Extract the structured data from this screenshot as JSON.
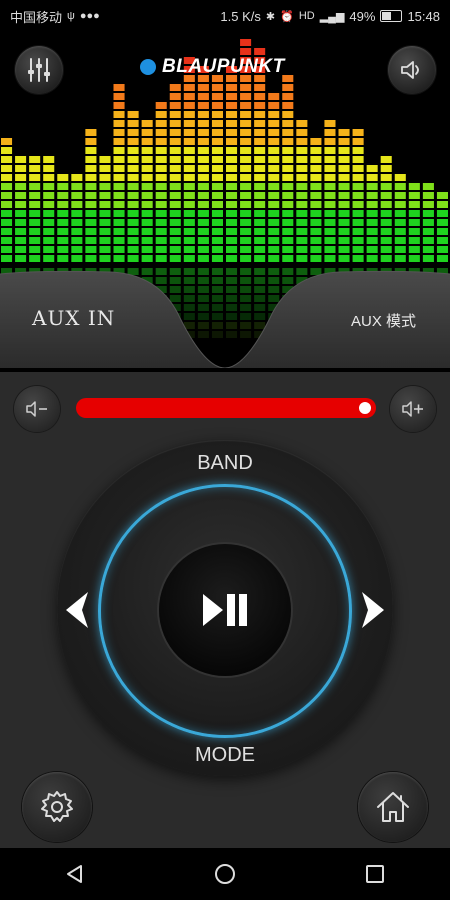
{
  "status_bar": {
    "carrier": "中国移动",
    "network_speed": "1.5 K/s",
    "battery": "49%",
    "time": "15:48",
    "signal_label": "HD"
  },
  "header": {
    "brand": "BLAUPUNKT",
    "eq_button_icon": "equalizer-sliders-icon",
    "sound_button_icon": "speaker-icon"
  },
  "source": {
    "left_label": "AUX IN",
    "right_label": "AUX 模式"
  },
  "volume": {
    "level": 1.0,
    "minus_icon": "volume-down-icon",
    "plus_icon": "volume-up-icon",
    "track_color": "#e60000"
  },
  "dial": {
    "top_label": "BAND",
    "bottom_label": "MODE",
    "center_icon": "play-pause-icon",
    "ring_color": "#3aa8d8"
  },
  "footer": {
    "settings_icon": "gear-icon",
    "home_icon": "home-icon"
  },
  "nav": {
    "back_icon": "back-triangle-icon",
    "home_icon": "circle-home-icon",
    "recents_icon": "square-recents-icon"
  },
  "eq_levels": [
    14,
    12,
    12,
    12,
    10,
    10,
    15,
    12,
    20,
    17,
    16,
    18,
    20,
    23,
    22,
    21,
    22,
    25,
    24,
    19,
    21,
    16,
    14,
    16,
    15,
    15,
    11,
    12,
    10,
    9,
    9,
    8
  ]
}
